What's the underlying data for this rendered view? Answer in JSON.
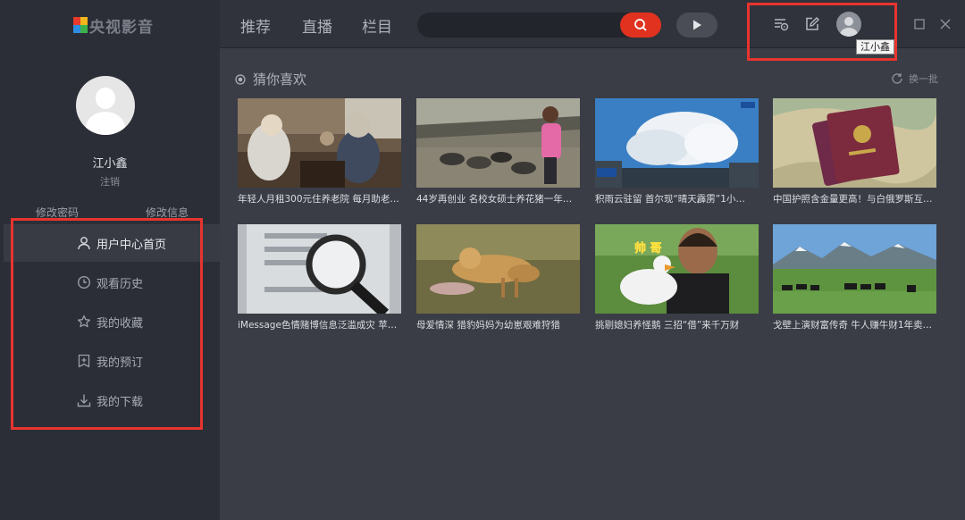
{
  "app": {
    "logo_text": "央视影音"
  },
  "user": {
    "name": "江小鑫",
    "logout": "注销",
    "change_password": "修改密码",
    "edit_info": "修改信息"
  },
  "menu": [
    {
      "label": "用户中心首页",
      "icon": "user-icon",
      "active": true
    },
    {
      "label": "观看历史",
      "icon": "clock-icon"
    },
    {
      "label": "我的收藏",
      "icon": "star-icon"
    },
    {
      "label": "我的预订",
      "icon": "bookmark-plus-icon"
    },
    {
      "label": "我的下载",
      "icon": "download-icon"
    }
  ],
  "topnav": {
    "tabs": [
      "推荐",
      "直播",
      "栏目"
    ],
    "search_placeholder": ""
  },
  "tooltip": "江小鑫",
  "section": {
    "title": "猜你喜欢",
    "refresh": "换一批"
  },
  "videos": [
    {
      "title": "年轻人月租300元住养老院 每月助老…"
    },
    {
      "title": "44岁再创业 名校女硕士养花猪一年巧…"
    },
    {
      "title": "积雨云驻留 首尔现“晴天霹雳”1小…"
    },
    {
      "title": "中国护照含金量更高！与白俄罗斯互…"
    },
    {
      "title": "iMessage色情赌博信息泛滥成灾 苹果…"
    },
    {
      "title": "母爱情深 猎豹妈妈为幼崽艰难狩猎"
    },
    {
      "title": "挑剔媳妇养怪鹅 三招“借”来千万财",
      "overlay_text": "帅 哥"
    },
    {
      "title": "戈壁上演财富传奇 牛人赚牛财1年卖…"
    }
  ],
  "colors": {
    "accent_red": "#e8342f",
    "search_red": "#e0321f",
    "sidebar_bg": "#2b2e36",
    "main_bg": "#3a3d46"
  }
}
